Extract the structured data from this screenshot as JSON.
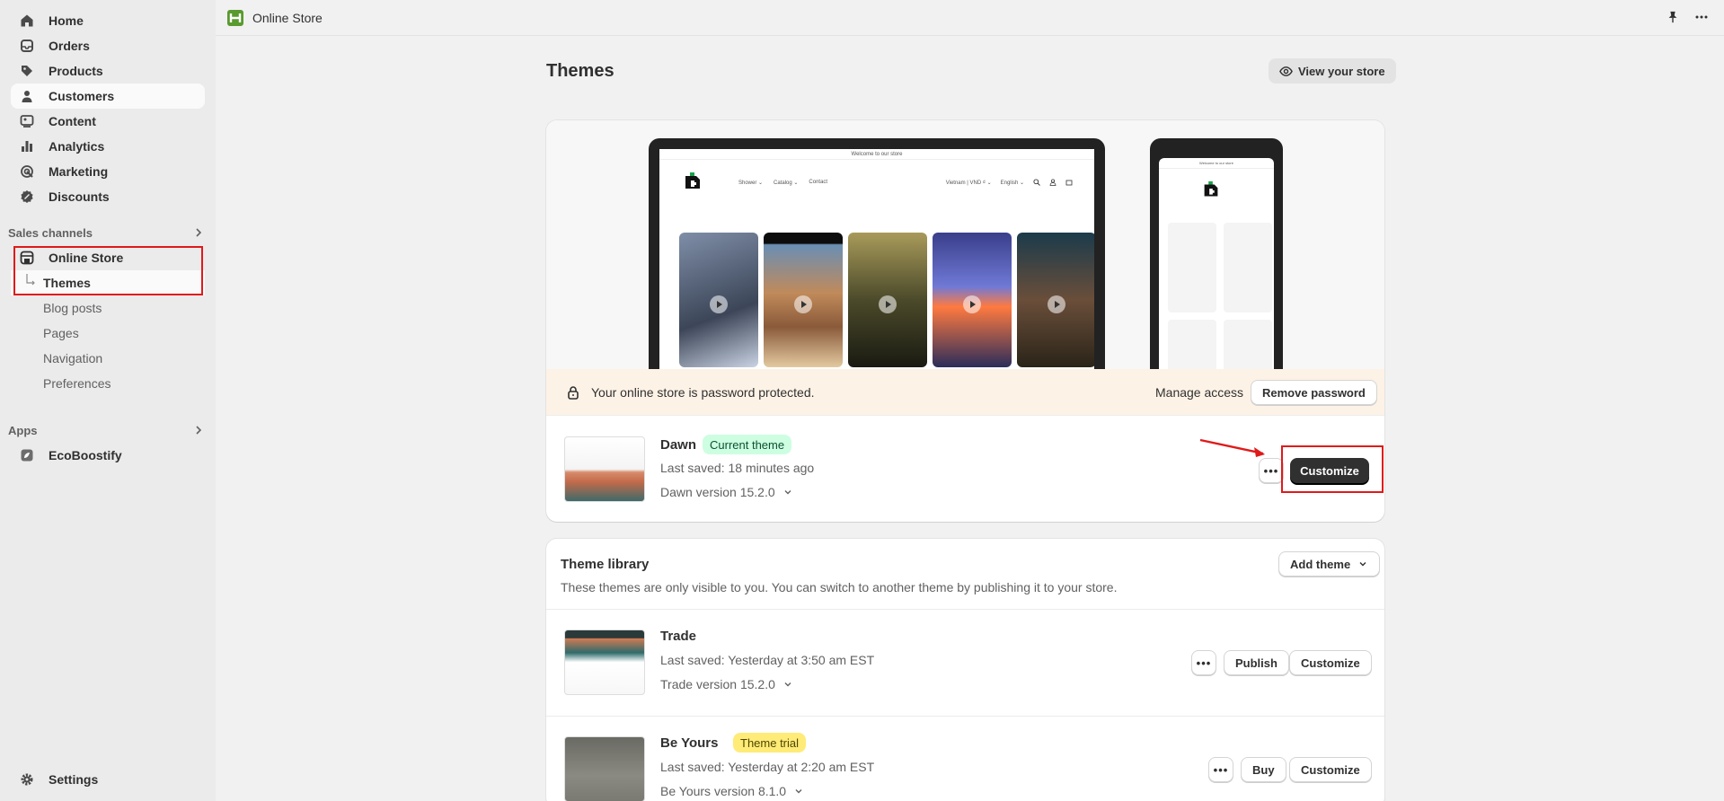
{
  "sidebar": {
    "items": [
      {
        "label": "Home",
        "icon": "home-icon"
      },
      {
        "label": "Orders",
        "icon": "orders-icon"
      },
      {
        "label": "Products",
        "icon": "tag-icon"
      },
      {
        "label": "Customers",
        "icon": "person-icon"
      },
      {
        "label": "Content",
        "icon": "content-icon"
      },
      {
        "label": "Analytics",
        "icon": "bar-chart-icon"
      },
      {
        "label": "Marketing",
        "icon": "target-icon"
      },
      {
        "label": "Discounts",
        "icon": "discount-icon"
      }
    ],
    "sales_channels_label": "Sales channels",
    "online_store": "Online Store",
    "sub_items": [
      "Themes",
      "Blog posts",
      "Pages",
      "Navigation",
      "Preferences"
    ],
    "apps_label": "Apps",
    "app_item": "EcoBoostify",
    "settings": "Settings"
  },
  "topbar": {
    "title": "Online Store"
  },
  "main": {
    "title": "Themes",
    "view_store": "View your store"
  },
  "preview": {
    "announcement": "Welcome to our store",
    "nav": [
      "Shower ⌄",
      "Catalog ⌄",
      "Contact"
    ],
    "locale": "Vietnam | VND ₫ ⌄",
    "language": "English ⌄"
  },
  "password_bar": {
    "message": "Your online store is password protected.",
    "manage": "Manage access",
    "remove": "Remove password"
  },
  "current_theme": {
    "name": "Dawn",
    "badge": "Current theme",
    "saved": "Last saved: 18 minutes ago",
    "version": "Dawn version 15.2.0",
    "dots": "•••",
    "customize": "Customize"
  },
  "library": {
    "title": "Theme library",
    "subtitle": "These themes are only visible to you. You can switch to another theme by publishing it to your store.",
    "add_theme": "Add theme",
    "themes": [
      {
        "name": "Trade",
        "saved": "Last saved: Yesterday at 3:50 am EST",
        "version": "Trade version 15.2.0",
        "action": "Publish",
        "customize": "Customize",
        "dots": "•••"
      },
      {
        "name": "Be Yours",
        "badge": "Theme trial",
        "saved": "Last saved: Yesterday at 2:20 am EST",
        "version": "Be Yours version 8.1.0",
        "action": "Buy",
        "customize": "Customize",
        "dots": "•••"
      }
    ]
  },
  "colors": {
    "accent_dark": "#303030",
    "current_badge": "#cdfee1",
    "trial_badge": "#ffeb78",
    "highlight": "#e01a1a"
  }
}
